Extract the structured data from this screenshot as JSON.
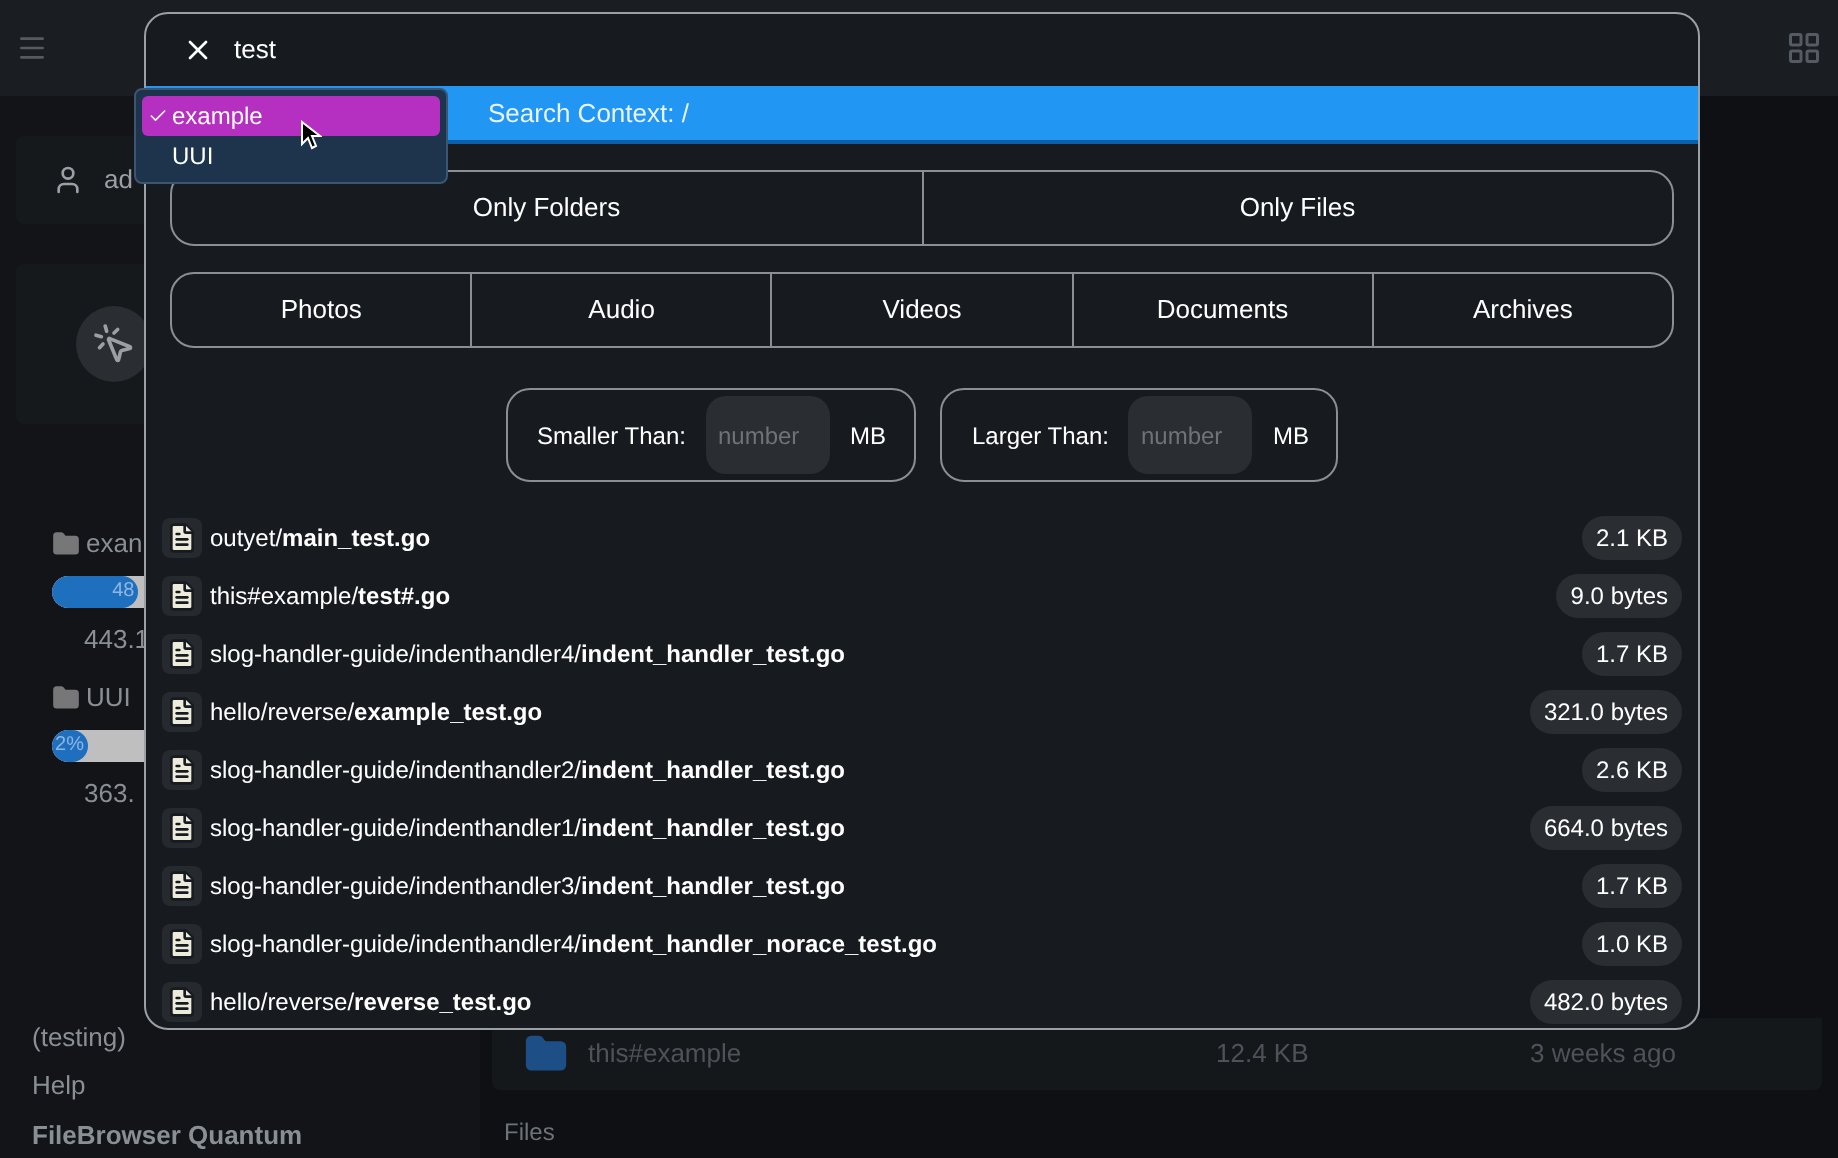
{
  "sidebar": {
    "user": "ad",
    "storage": [
      {
        "name": "exan",
        "badge": "48",
        "level": 0.48,
        "size": "443.1"
      },
      {
        "name": "UUI",
        "badge": "2%",
        "level": 0.02,
        "size": "363."
      }
    ],
    "links": [
      {
        "label": "(testing)",
        "kind": "text"
      },
      {
        "label": "Help",
        "kind": "link"
      },
      {
        "label": "FileBrowser Quantum",
        "kind": "brand"
      }
    ]
  },
  "main": {
    "row": {
      "name": "this#example",
      "size": "12.4 KB",
      "modified": "3 weeks ago"
    },
    "section": "Files"
  },
  "search": {
    "value": "test",
    "context": "Search Context: /",
    "sources": [
      {
        "label": "example",
        "selected": true
      },
      {
        "label": "UUI",
        "selected": false
      }
    ],
    "type_rows": [
      [
        "Only Folders",
        "Only Files"
      ],
      [
        "Photos",
        "Audio",
        "Videos",
        "Documents",
        "Archives"
      ]
    ],
    "size_filters": [
      {
        "label": "Smaller Than:",
        "placeholder": "number",
        "unit": "MB"
      },
      {
        "label": "Larger Than:",
        "placeholder": "number",
        "unit": "MB"
      }
    ],
    "results": [
      {
        "path": "outyet/**main_test.go**",
        "size": "2.1 KB"
      },
      {
        "path": "this#example/**test#.go**",
        "size": "9.0 bytes"
      },
      {
        "path": "slog-handler-guide/indenthandler4/**indent_handler_test.go**",
        "size": "1.7 KB"
      },
      {
        "path": "hello/reverse/**example_test.go**",
        "size": "321.0 bytes"
      },
      {
        "path": "slog-handler-guide/indenthandler2/**indent_handler_test.go**",
        "size": "2.6 KB"
      },
      {
        "path": "slog-handler-guide/indenthandler1/**indent_handler_test.go**",
        "size": "664.0 bytes"
      },
      {
        "path": "slog-handler-guide/indenthandler3/**indent_handler_test.go**",
        "size": "1.7 KB"
      },
      {
        "path": "slog-handler-guide/indenthandler4/**indent_handler_norace_test.go**",
        "size": "1.0 KB"
      },
      {
        "path": "hello/reverse/**reverse_test.go**",
        "size": "482.0 bytes"
      }
    ]
  }
}
